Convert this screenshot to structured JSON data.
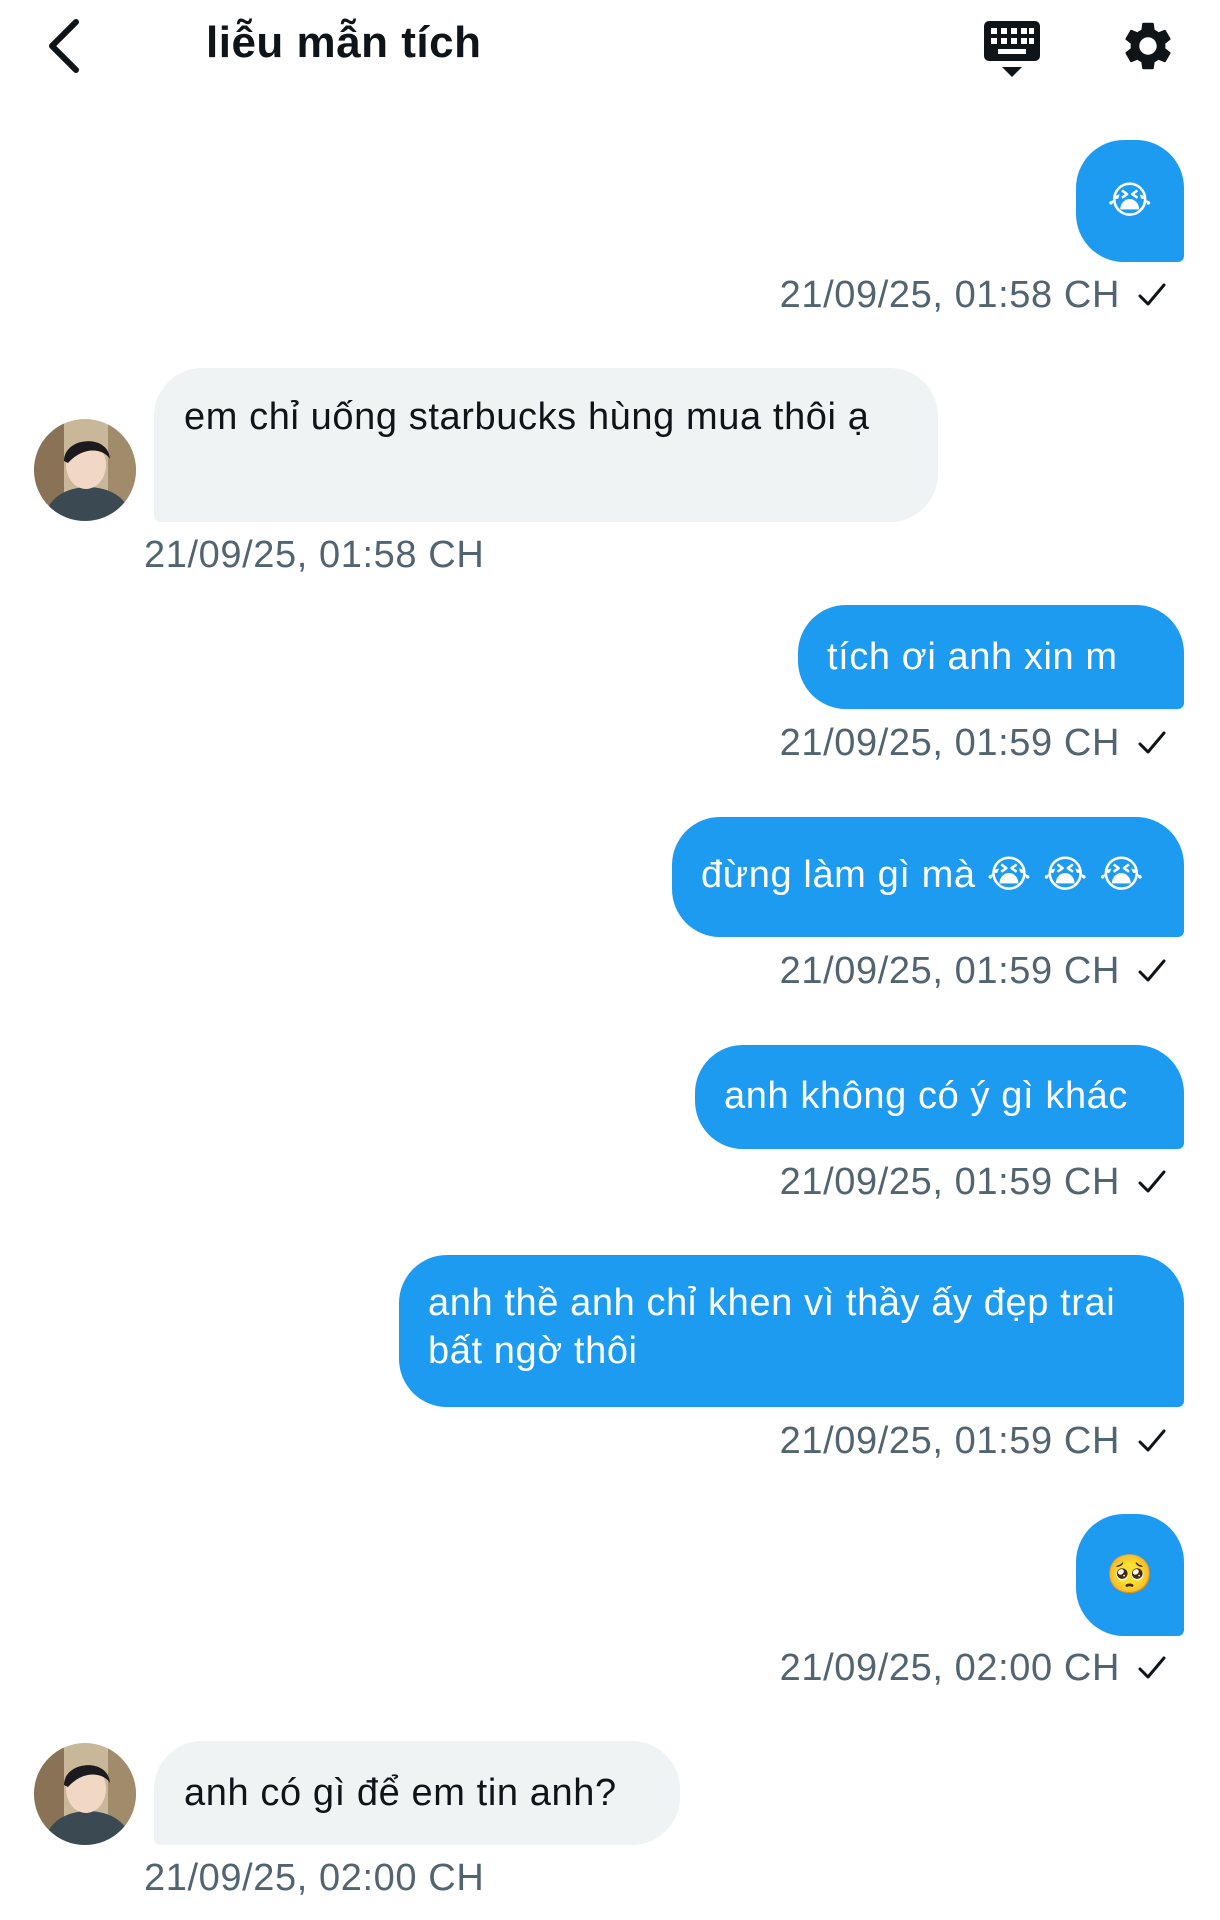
{
  "header": {
    "title": "liễu mẫn tích"
  },
  "messages": [
    {
      "direction": "out",
      "text": "😭",
      "timestamp": "21/09/25, 01:58 CH"
    },
    {
      "direction": "in",
      "text": "em chỉ uống starbucks hùng mua thôi ạ",
      "timestamp": "21/09/25, 01:58 CH"
    },
    {
      "direction": "out",
      "text": "tích ơi anh xin m",
      "timestamp": "21/09/25, 01:59 CH"
    },
    {
      "direction": "out",
      "text": "đừng làm gì mà 😭 😭 😭",
      "timestamp": "21/09/25, 01:59 CH"
    },
    {
      "direction": "out",
      "text": "anh không có ý gì khác",
      "timestamp": "21/09/25, 01:59 CH"
    },
    {
      "direction": "out",
      "text": "anh thề anh chỉ khen vì thầy ấy đẹp trai bất ngờ thôi",
      "timestamp": "21/09/25, 01:59 CH"
    },
    {
      "direction": "out",
      "text": "🥺",
      "timestamp": "21/09/25, 02:00 CH"
    },
    {
      "direction": "in",
      "text": "anh có gì để em tin anh?",
      "timestamp": "21/09/25, 02:00 CH"
    }
  ],
  "colors": {
    "outgoing_bubble": "#1d9bf0",
    "incoming_bubble": "#eff3f4",
    "timestamp_text": "#536471"
  },
  "icons": [
    "back-arrow-icon",
    "keyboard-icon",
    "gear-icon",
    "read-check-icon"
  ]
}
